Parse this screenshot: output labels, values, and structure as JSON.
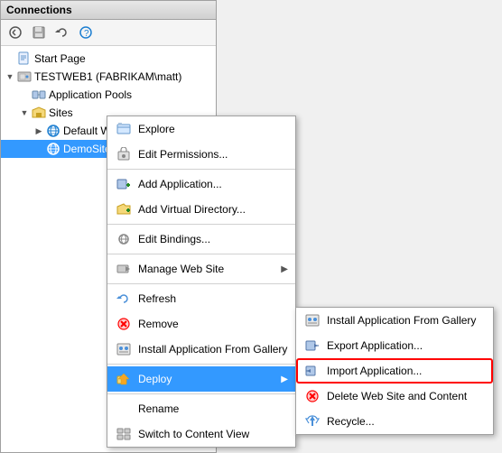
{
  "panel": {
    "title": "Connections",
    "toolbar": {
      "back": "◀",
      "save": "💾",
      "refresh": "↺",
      "help": "🔍"
    }
  },
  "tree": {
    "items": [
      {
        "id": "start-page",
        "label": "Start Page",
        "indent": 1,
        "icon": "page",
        "expandable": false
      },
      {
        "id": "server",
        "label": "TESTWEB1 (FABRIKAM\\matt)",
        "indent": 1,
        "icon": "computer",
        "expandable": true,
        "expanded": true
      },
      {
        "id": "app-pools",
        "label": "Application Pools",
        "indent": 2,
        "icon": "pool",
        "expandable": false
      },
      {
        "id": "sites",
        "label": "Sites",
        "indent": 2,
        "icon": "folder",
        "expandable": true,
        "expanded": true
      },
      {
        "id": "default-web-site",
        "label": "Default Web Site",
        "indent": 3,
        "icon": "globe",
        "expandable": true,
        "expanded": false
      },
      {
        "id": "demo-site",
        "label": "DemoSite",
        "indent": 3,
        "icon": "globe",
        "expandable": false,
        "selected": true
      }
    ]
  },
  "context_menu": {
    "items": [
      {
        "id": "explore",
        "label": "Explore",
        "icon": "explore",
        "has_arrow": false,
        "separator_after": false
      },
      {
        "id": "edit-permissions",
        "label": "Edit Permissions...",
        "icon": "permissions",
        "has_arrow": false,
        "separator_after": true
      },
      {
        "id": "add-application",
        "label": "Add Application...",
        "icon": "app",
        "has_arrow": false,
        "separator_after": false
      },
      {
        "id": "add-virtual-directory",
        "label": "Add Virtual Directory...",
        "icon": "app",
        "has_arrow": false,
        "separator_after": true
      },
      {
        "id": "edit-bindings",
        "label": "Edit Bindings...",
        "icon": "permissions",
        "has_arrow": false,
        "separator_after": true
      },
      {
        "id": "manage-web-site",
        "label": "Manage Web Site",
        "icon": "manage",
        "has_arrow": true,
        "separator_after": true
      },
      {
        "id": "refresh",
        "label": "Refresh",
        "icon": "refresh",
        "has_arrow": false,
        "separator_after": false
      },
      {
        "id": "remove",
        "label": "Remove",
        "icon": "remove",
        "has_arrow": false,
        "separator_after": false
      },
      {
        "id": "install-from-gallery",
        "label": "Install Application From Gallery",
        "icon": "install",
        "has_arrow": false,
        "separator_after": true
      },
      {
        "id": "deploy",
        "label": "Deploy",
        "icon": "deploy",
        "has_arrow": true,
        "highlighted": true,
        "separator_after": true
      },
      {
        "id": "rename",
        "label": "Rename",
        "icon": "none",
        "has_arrow": false,
        "separator_after": false
      },
      {
        "id": "switch-content-view",
        "label": "Switch to Content View",
        "icon": "switch",
        "has_arrow": false,
        "separator_after": false
      }
    ]
  },
  "submenu": {
    "items": [
      {
        "id": "install-from-gallery-sub",
        "label": "Install Application From Gallery",
        "icon": "gallery"
      },
      {
        "id": "export-application",
        "label": "Export Application...",
        "icon": "export"
      },
      {
        "id": "import-application",
        "label": "Import Application...",
        "icon": "import",
        "highlighted": true
      },
      {
        "id": "delete-website",
        "label": "Delete Web Site and Content",
        "icon": "delete"
      },
      {
        "id": "recycle",
        "label": "Recycle...",
        "icon": "recycle"
      }
    ]
  }
}
